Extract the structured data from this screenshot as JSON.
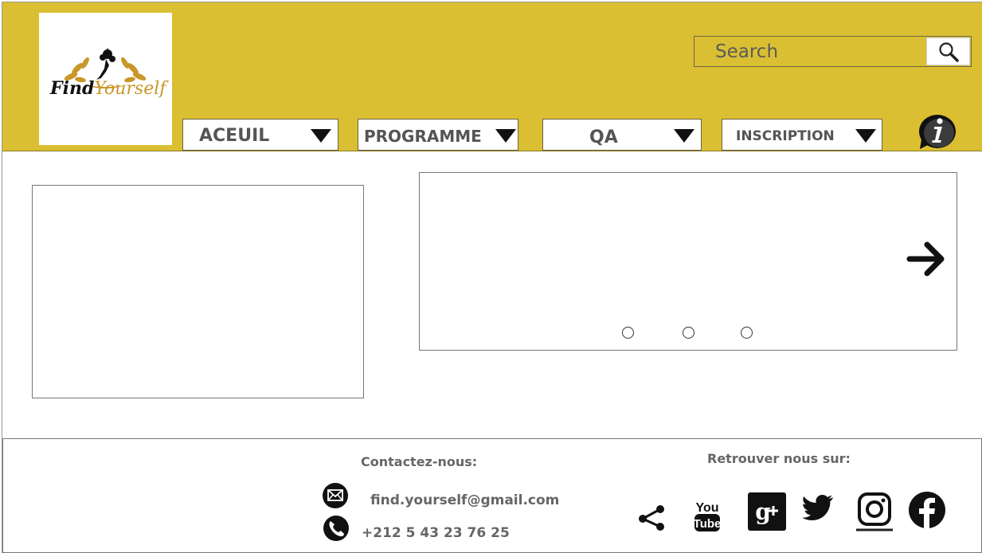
{
  "header": {
    "logo": {
      "text_find": "Find",
      "text_yourself": "Yourself"
    },
    "search": {
      "placeholder": "Search"
    },
    "nav": [
      {
        "label": "ACEUIL"
      },
      {
        "label": "PROGRAMME"
      },
      {
        "label": "QA"
      },
      {
        "label": "INSCRIPTION"
      }
    ]
  },
  "footer": {
    "contact_heading": "Contactez-nous:",
    "email": "find.yourself@gmail.com",
    "phone": "+212 5 43 23 76 25",
    "social_heading": "Retrouver nous sur:",
    "social_icons": [
      "share-icon",
      "youtube-icon",
      "google-plus-icon",
      "twitter-icon",
      "instagram-icon",
      "facebook-icon"
    ]
  },
  "colors": {
    "header_bg": "#dbbf33",
    "text_gray": "#555555",
    "logo_gold": "#c9962a"
  }
}
